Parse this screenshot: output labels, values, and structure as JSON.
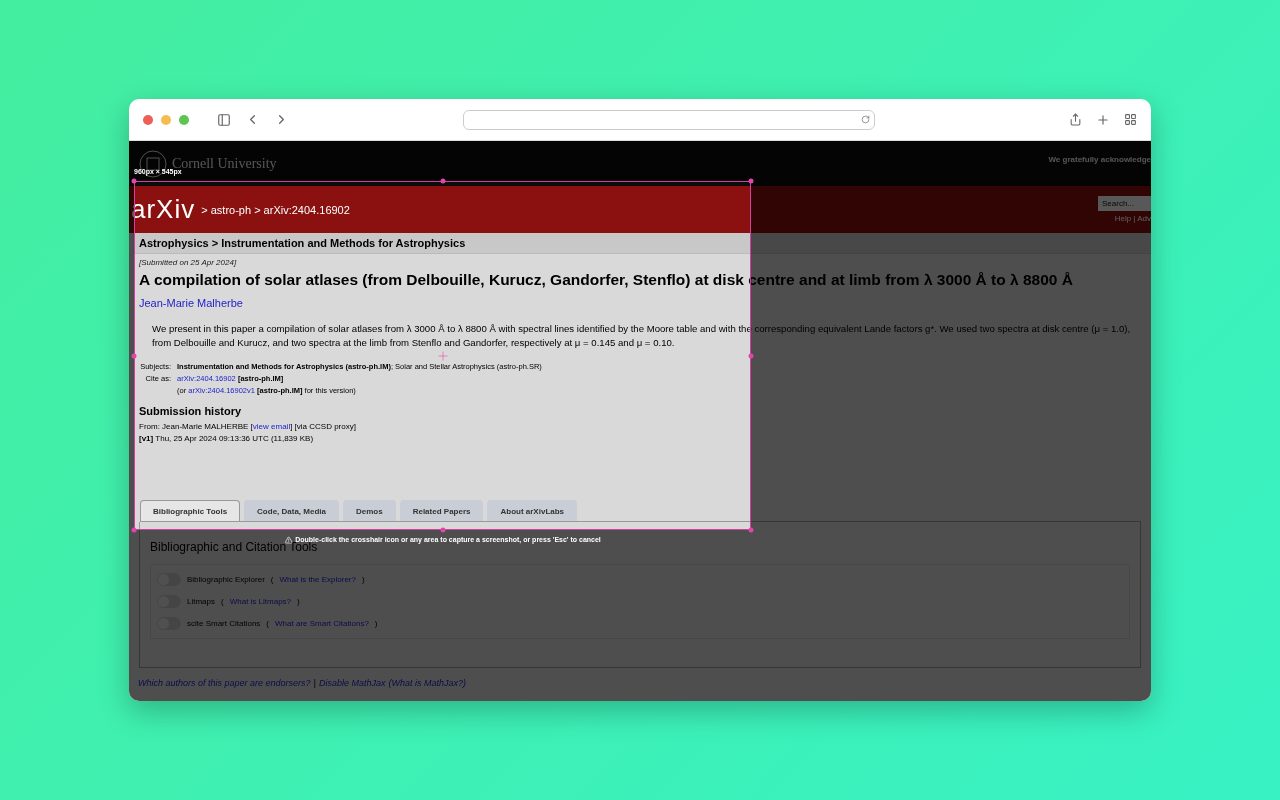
{
  "header": {
    "institution": "Cornell University",
    "acknowledgement": "We gratefully acknowledge"
  },
  "banner": {
    "logo": "arXiv",
    "breadcrumb": "> astro-ph > arXiv:2404.16902",
    "search": {
      "placeholder": "Search..."
    },
    "links": "Help | Adv"
  },
  "subject_bar": "Astrophysics > Instrumentation and Methods for Astrophysics",
  "dateline": "[Submitted on 25 Apr 2024]",
  "title": "A compilation of solar atlases (from Delbouille, Kurucz, Gandorfer, Stenflo) at disk centre and at limb from λ 3000 Å to λ 8800 Å",
  "authors": [
    "Jean-Marie Malherbe"
  ],
  "abstract": "We present in this paper a compilation of solar atlases from λ 3000 Å to λ 8800 Å with spectral lines identified by the Moore table and with the corresponding equivalent Lande factors g*. We used two spectra at disk centre (μ = 1.0), from Delbouille and Kurucz, and two spectra at the limb from Stenflo and Gandorfer, respectively at μ = 0.145 and μ = 0.10.",
  "metadata": [
    {
      "label": "Subjects:",
      "text": "**Instrumentation and Methods for Astrophysics (astro-ph.IM)**; Solar and Stellar Astrophysics (astro-ph.SR)"
    },
    {
      "label": "Cite as:",
      "link": "arXiv:2404.16902",
      "text": " **[astro-ph.IM]**"
    },
    {
      "prefix": "(or ",
      "link": "arXiv:2404.16902v1",
      "text": " **[astro-ph.IM]** for this version)"
    }
  ],
  "submission_history": {
    "heading": "Submission history",
    "from_prefix": "From: Jean-Marie MALHERBE [",
    "from_link": "view email",
    "from_suffix": "] [via CCSD proxy]",
    "versions": [
      "**[v1]** Thu, 25 Apr 2024 09:13:36 UTC (11,839 KB)"
    ]
  },
  "tabs": [
    {
      "label": "Bibliographic Tools",
      "selected": true
    },
    {
      "label": "Code, Data, Media",
      "selected": false
    },
    {
      "label": "Demos",
      "selected": false
    },
    {
      "label": "Related Papers",
      "selected": false
    },
    {
      "label": "About arXivLabs",
      "selected": false
    }
  ],
  "panel": {
    "heading": "Bibliographic and Citation Tools",
    "toggles": [
      {
        "label": "Bibliographic Explorer",
        "open": "(",
        "link": "What is the Explorer?",
        "close": ")",
        "on": false
      },
      {
        "label": "Litmaps",
        "open": "(",
        "link": "What is Litmaps?",
        "close": ")",
        "on": false
      },
      {
        "label": "scite Smart Citations",
        "open": "(",
        "link": "What are Smart Citations?",
        "close": ")",
        "on": false
      }
    ]
  },
  "footer": [
    {
      "kind": "link",
      "text": "Which authors of this paper are endorsers?"
    },
    {
      "kind": "separator",
      "text": "|"
    },
    {
      "kind": "link",
      "text": "Disable MathJax"
    },
    {
      "kind": "link",
      "text": "(What is MathJax?)"
    }
  ],
  "capture": {
    "size_label": "960px × 545px",
    "hint": "Double-click the crosshair icon or any area to capture a screenshot, or press 'Esc' to cancel"
  }
}
